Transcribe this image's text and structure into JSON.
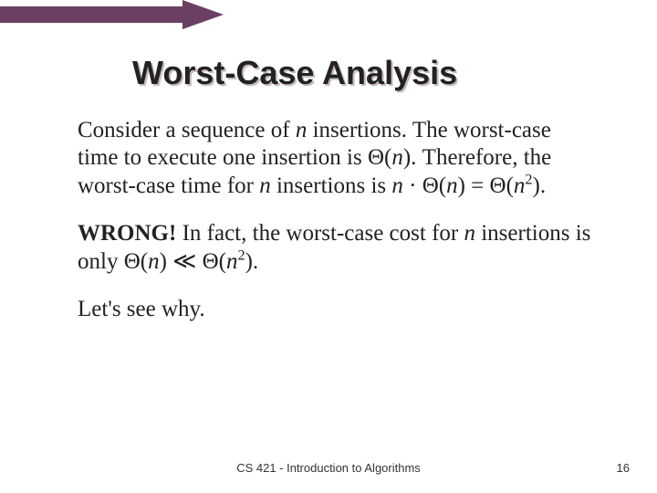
{
  "title": "Worst-Case Analysis",
  "para1": {
    "t1": "Consider a sequence of ",
    "n1": "n",
    "t2": " insertions.  The worst-case time to execute one insertion is Θ(",
    "n2": "n",
    "t3": ").  Therefore, the worst-case time for ",
    "n3": "n",
    "t4": " insertions is ",
    "n4": "n",
    "t5": " · Θ(",
    "n5": "n",
    "t6": ") = Θ(",
    "n6": "n",
    "sq1": "2",
    "t7": ")."
  },
  "para2": {
    "wrong": "WRONG!",
    "t1": "  In fact, the worst-case cost for ",
    "n1": "n",
    "t2": " insertions is only Θ(",
    "n2": "n",
    "t3": ")  ≪  Θ(",
    "n3": "n",
    "sq1": "2",
    "t4": ")."
  },
  "para3": "Let's see why.",
  "footer": "CS 421 - Introduction to Algorithms",
  "page": "16",
  "accent_color": "#6b3f62"
}
